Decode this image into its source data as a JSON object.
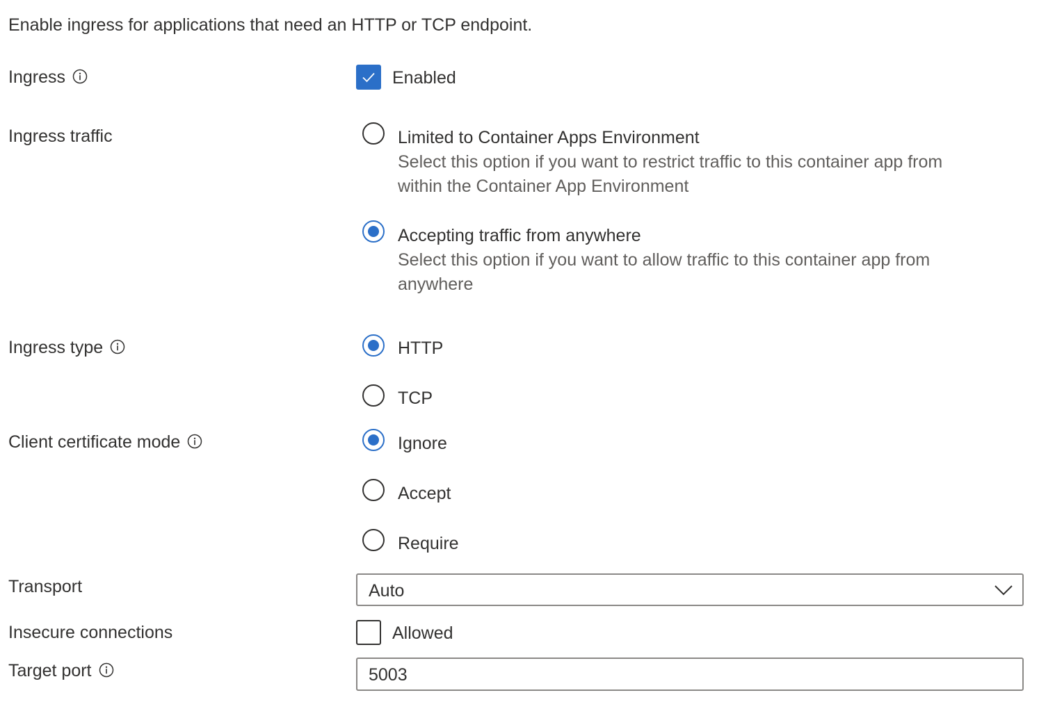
{
  "intro": "Enable ingress for applications that need an HTTP or TCP endpoint.",
  "ingress": {
    "label": "Ingress",
    "checkbox_label": "Enabled",
    "checked": true
  },
  "ingress_traffic": {
    "label": "Ingress traffic",
    "options": [
      {
        "label": "Limited to Container Apps Environment",
        "desc1": "Select this option if you want to restrict traffic to this container app from",
        "desc2": "within the Container App Environment",
        "selected": false
      },
      {
        "label": "Accepting traffic from anywhere",
        "desc1": "Select this option if you want to allow traffic to this container app from",
        "desc2": "anywhere",
        "selected": true
      }
    ]
  },
  "ingress_type": {
    "label": "Ingress type",
    "options": [
      {
        "label": "HTTP",
        "selected": true
      },
      {
        "label": "TCP",
        "selected": false
      }
    ]
  },
  "client_certificate_mode": {
    "label": "Client certificate mode",
    "options": [
      {
        "label": "Ignore",
        "selected": true
      },
      {
        "label": "Accept",
        "selected": false
      },
      {
        "label": "Require",
        "selected": false
      }
    ]
  },
  "transport": {
    "label": "Transport",
    "value": "Auto"
  },
  "insecure_connections": {
    "label": "Insecure connections",
    "checkbox_label": "Allowed",
    "checked": false
  },
  "target_port": {
    "label": "Target port",
    "value": "5003"
  },
  "colors": {
    "accent": "#2b6fc8",
    "text": "#323130",
    "secondary_text": "#605e5c",
    "border": "#8a8886"
  },
  "icons": {
    "info": "info-icon",
    "check": "check-icon",
    "dropdown": "chevron-down-icon"
  }
}
